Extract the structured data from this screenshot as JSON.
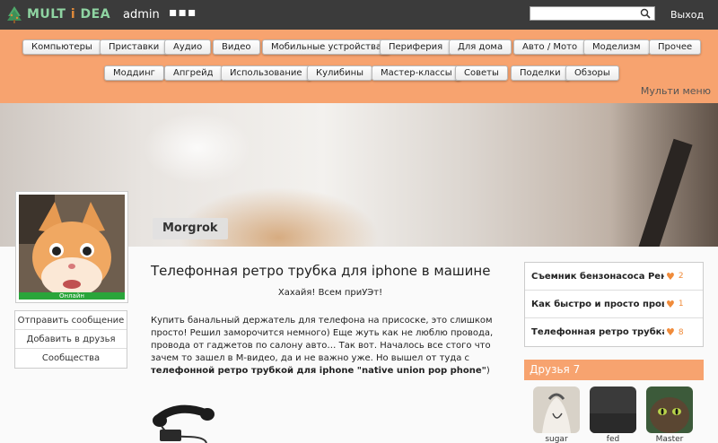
{
  "header": {
    "logo_text_a": "MULT",
    "logo_text_i": "i",
    "logo_text_b": "DEA",
    "username": "admin",
    "more_label": "▪▪▪",
    "search_placeholder": "",
    "logout_label": "Выход"
  },
  "menu": {
    "row1": [
      "Компьютеры",
      "Приставки",
      "Аудио",
      "Видео",
      "Мобильные устройства",
      "Периферия",
      "Для дома",
      "Авто / Мото",
      "Моделизм",
      "Прочее"
    ],
    "row2": [
      "Моддинг",
      "Апгрейд",
      "Использование",
      "Кулибины",
      "Мастер-классы",
      "Советы",
      "Поделки",
      "Обзоры"
    ],
    "multi_menu": "Мульти меню"
  },
  "profile": {
    "username_tag": "Morgrok",
    "status": "Онлайн",
    "actions": [
      "Отправить сообщение",
      "Добавить в друзья",
      "Сообщества"
    ]
  },
  "article": {
    "title": "Телефонная ретро трубка для iphone в машине",
    "greeting": "Хахайя! Всем приУЭт!",
    "text": "Купить банальный держатель для телефона на присоске, это слишком просто! Решил заморочится немного) Еще жуть как не люблю провода, провода от гаджетов по салону авто… Так вот. Началось все стого что зачем то зашел в М-видео, да и не важно уже. Но вышел от туда с ",
    "text_bold": "телефонной ретро трубкой для iphone \"native union pop phone\"",
    "text_end": ")"
  },
  "related": [
    {
      "title": "Съемник бензонасоса Рено Ке",
      "count": "2"
    },
    {
      "title": "Как быстро и просто проверит",
      "count": "1"
    },
    {
      "title": "Телефонная ретро трубка для i",
      "count": "8"
    }
  ],
  "friends": {
    "header": "Друзья 7",
    "list": [
      {
        "name": "sugar"
      },
      {
        "name": "fed"
      },
      {
        "name": "Master"
      }
    ]
  },
  "colors": {
    "accent": "#f7a36f",
    "topbar": "#3b3b3b",
    "online": "#2aa53a",
    "heart": "#f08b3a"
  },
  "icons": [
    "tree-logo-icon",
    "search-icon",
    "heart-icon"
  ]
}
